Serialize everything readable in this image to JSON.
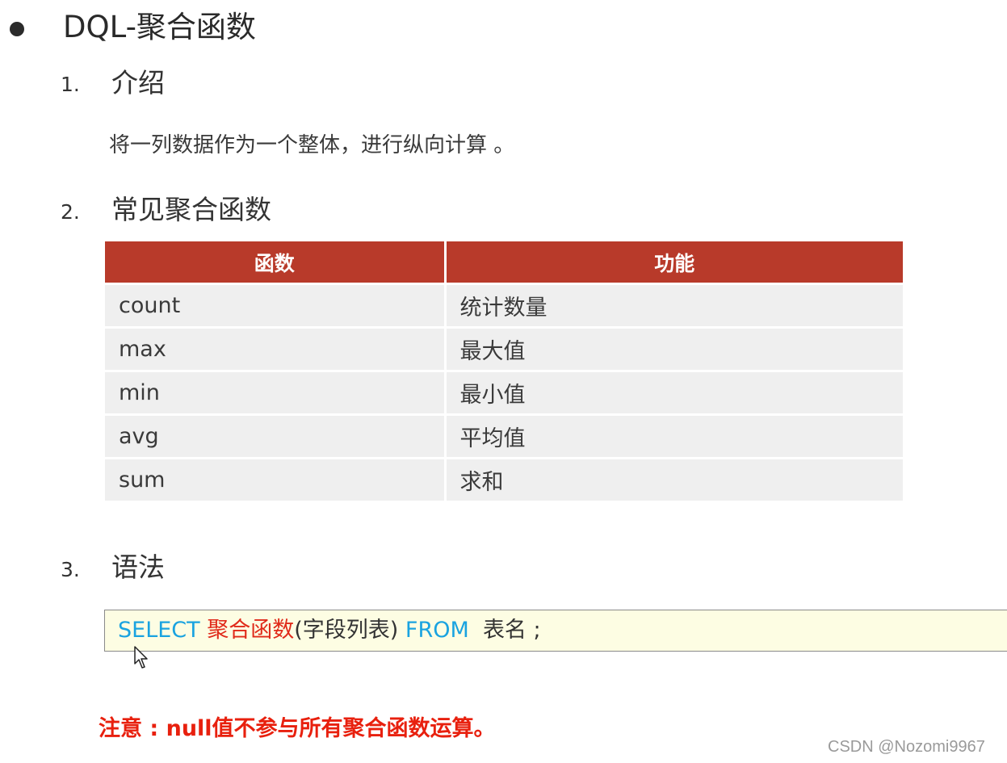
{
  "title": "DQL-聚合函数",
  "sections": [
    {
      "num": "1.",
      "title": "介绍"
    },
    {
      "num": "2.",
      "title": "常见聚合函数"
    },
    {
      "num": "3.",
      "title": "语法"
    }
  ],
  "intro_text": "将一列数据作为一个整体，进行纵向计算 。",
  "table": {
    "headers": [
      "函数",
      "功能"
    ],
    "rows": [
      [
        "count",
        "统计数量"
      ],
      [
        "max",
        "最大值"
      ],
      [
        "min",
        "最小值"
      ],
      [
        "avg",
        "平均值"
      ],
      [
        "sum",
        "求和"
      ]
    ],
    "header_color": "#b83a2a",
    "row_color": "#efefef"
  },
  "syntax": {
    "select_kw": "SELECT",
    "agg_fn": "聚合函数",
    "field_list": "(字段列表)",
    "from_kw": "FROM",
    "table_name": "表名 ;",
    "keyword_color": "#1aa3e0",
    "function_color": "#e02a1a",
    "box_color": "#fdfde3"
  },
  "cursor_icon": "mouse-pointer-icon",
  "note": "注意 : null值不参与所有聚合函数运算。",
  "watermark": "CSDN @Nozomi9967"
}
